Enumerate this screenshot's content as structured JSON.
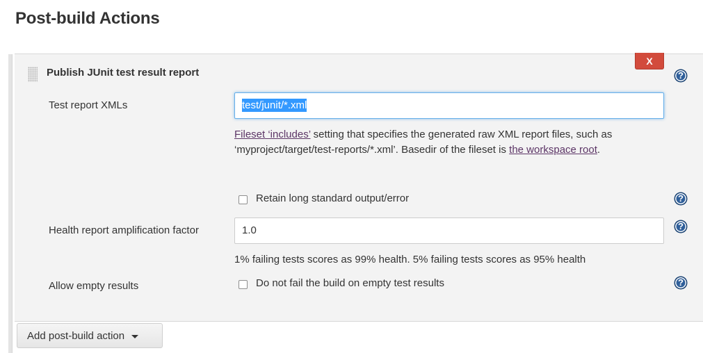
{
  "section": {
    "title": "Post-build Actions"
  },
  "step": {
    "title": "Publish JUnit test result report",
    "delete_label": "X",
    "fields": {
      "test_report": {
        "label": "Test report XMLs",
        "value": "test/junit/*.xml",
        "desc_link1": "Fileset ‘includes’",
        "desc_text1": " setting that specifies the generated raw XML report files, such as ‘myproject/target/test-reports/*.xml’. Basedir of the fileset is ",
        "desc_link2": "the workspace root",
        "desc_text2": "."
      },
      "retain_output": {
        "label": "Retain long standard output/error",
        "checked": false
      },
      "health_factor": {
        "label": "Health report amplification factor",
        "value": "1.0",
        "desc": "1% failing tests scores as 99% health. 5% failing tests scores as 95% health"
      },
      "allow_empty": {
        "label": "Allow empty results",
        "checkbox_label": "Do not fail the build on empty test results",
        "checked": false
      }
    }
  },
  "help_glyph": "?",
  "add_action": {
    "label": "Add post-build action"
  },
  "colors": {
    "delete_button": "#d24b3c",
    "help_icon": "#2f5f9a",
    "selection": "#3399ff",
    "link": "#5c3566",
    "panel_bg": "#f3f3f3"
  }
}
